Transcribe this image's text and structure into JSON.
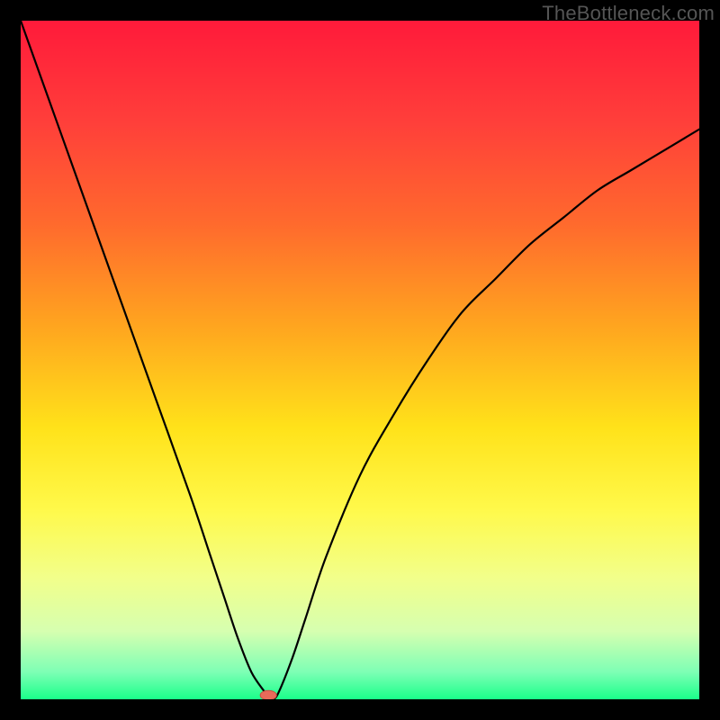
{
  "watermark": "TheBottleneck.com",
  "chart_data": {
    "type": "line",
    "title": "",
    "xlabel": "",
    "ylabel": "",
    "xlim": [
      0,
      100
    ],
    "ylim": [
      0,
      100
    ],
    "background_gradient": {
      "type": "vertical",
      "stops": [
        {
          "pos": 0.0,
          "color": "#ff1a3a"
        },
        {
          "pos": 0.15,
          "color": "#ff3f3a"
        },
        {
          "pos": 0.3,
          "color": "#ff6a2d"
        },
        {
          "pos": 0.45,
          "color": "#ffa51f"
        },
        {
          "pos": 0.6,
          "color": "#ffe21a"
        },
        {
          "pos": 0.72,
          "color": "#fff94a"
        },
        {
          "pos": 0.82,
          "color": "#f2ff8a"
        },
        {
          "pos": 0.9,
          "color": "#d6ffb0"
        },
        {
          "pos": 0.96,
          "color": "#7dffb5"
        },
        {
          "pos": 1.0,
          "color": "#1aff8a"
        }
      ]
    },
    "series": [
      {
        "name": "bottleneck-curve",
        "x": [
          0,
          5,
          10,
          15,
          20,
          25,
          28,
          30,
          32,
          34,
          36,
          36.6,
          37.2,
          38,
          40,
          42,
          45,
          50,
          55,
          60,
          65,
          70,
          75,
          80,
          85,
          90,
          95,
          100
        ],
        "values": [
          100,
          86,
          72,
          58,
          44,
          30,
          21,
          15,
          9,
          4,
          1,
          0,
          0,
          1,
          6,
          12,
          21,
          33,
          42,
          50,
          57,
          62,
          67,
          71,
          75,
          78,
          81,
          84
        ]
      }
    ],
    "marker": {
      "name": "optimum-point",
      "x": 36.5,
      "y": 0.6,
      "rx": 1.2,
      "ry": 0.7,
      "color": "#e96a5a"
    }
  }
}
